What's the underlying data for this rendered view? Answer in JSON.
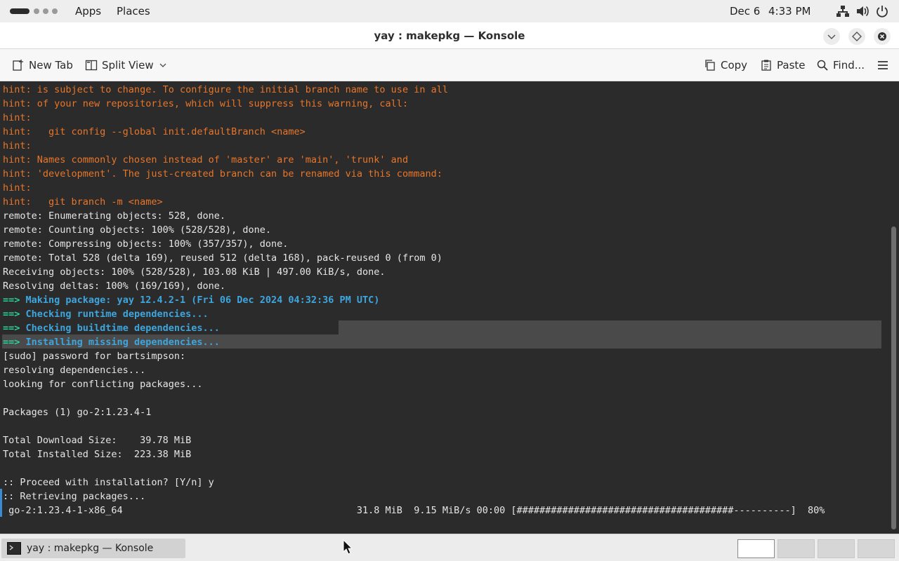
{
  "top_panel": {
    "apps_label": "Apps",
    "places_label": "Places",
    "date": "Dec 6",
    "time": "4:33 PM",
    "tray_icons": [
      "network-icon",
      "volume-icon",
      "power-icon"
    ]
  },
  "window": {
    "title": "yay : makepkg — Konsole"
  },
  "toolbar": {
    "new_tab_label": "New Tab",
    "split_view_label": "Split View",
    "copy_label": "Copy",
    "paste_label": "Paste",
    "find_label": "Find..."
  },
  "terminal": {
    "lines": [
      {
        "kind": "hint",
        "text": "hint: is subject to change. To configure the initial branch name to use in all"
      },
      {
        "kind": "hint",
        "text": "hint: of your new repositories, which will suppress this warning, call:"
      },
      {
        "kind": "hint",
        "text": "hint:"
      },
      {
        "kind": "hint",
        "text": "hint:   git config --global init.defaultBranch <name>"
      },
      {
        "kind": "hint",
        "text": "hint:"
      },
      {
        "kind": "hint",
        "text": "hint: Names commonly chosen instead of 'master' are 'main', 'trunk' and"
      },
      {
        "kind": "hint",
        "text": "hint: 'development'. The just-created branch can be renamed via this command:"
      },
      {
        "kind": "hint",
        "text": "hint:"
      },
      {
        "kind": "hint",
        "text": "hint:   git branch -m <name>"
      },
      {
        "kind": "plain",
        "text": "remote: Enumerating objects: 528, done."
      },
      {
        "kind": "plain",
        "text": "remote: Counting objects: 100% (528/528), done."
      },
      {
        "kind": "plain",
        "text": "remote: Compressing objects: 100% (357/357), done."
      },
      {
        "kind": "plain",
        "text": "remote: Total 528 (delta 169), reused 512 (delta 168), pack-reused 0 (from 0)"
      },
      {
        "kind": "plain",
        "text": "Receiving objects: 100% (528/528), 103.08 KiB | 497.00 KiB/s, done."
      },
      {
        "kind": "plain",
        "text": "Resolving deltas: 100% (169/169), done."
      },
      {
        "kind": "arrow",
        "arrow": "==>",
        "text": " Making package: yay 12.4.2-1 (Fri 06 Dec 2024 04:32:36 PM UTC)"
      },
      {
        "kind": "arrow",
        "arrow": "==>",
        "text": " Checking runtime dependencies..."
      },
      {
        "kind": "arrow",
        "arrow": "==>",
        "text": " Checking buildtime dependencies..."
      },
      {
        "kind": "arrow",
        "arrow": "==>",
        "text": " Installing missing dependencies..."
      },
      {
        "kind": "plain",
        "text": "[sudo] password for bartsimpson:"
      },
      {
        "kind": "plain",
        "text": "resolving dependencies..."
      },
      {
        "kind": "plain",
        "text": "looking for conflicting packages..."
      },
      {
        "kind": "plain",
        "text": ""
      },
      {
        "kind": "plain",
        "text": "Packages (1) go-2:1.23.4-1"
      },
      {
        "kind": "plain",
        "text": ""
      },
      {
        "kind": "plain",
        "text": "Total Download Size:    39.78 MiB"
      },
      {
        "kind": "plain",
        "text": "Total Installed Size:  223.38 MiB"
      },
      {
        "kind": "plain",
        "text": ""
      },
      {
        "kind": "plain",
        "text": ":: Proceed with installation? [Y/n] y"
      },
      {
        "kind": "plain",
        "text": ":: Retrieving packages..."
      },
      {
        "kind": "plain",
        "text": " go-2:1.23.4-1-x86_64                                         31.8 MiB  9.15 MiB/s 00:00 [######################################----------]  80%"
      }
    ],
    "download_progress_percent": 80
  },
  "taskbar": {
    "task_label": "yay : makepkg — Konsole",
    "workspaces": 4,
    "active_workspace": 1
  }
}
